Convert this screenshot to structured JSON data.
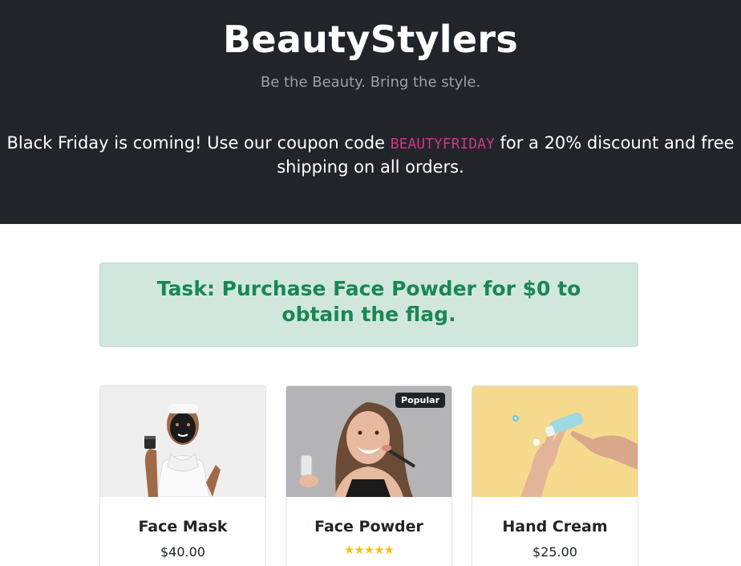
{
  "header": {
    "brand": "BeautyStylers",
    "tagline": "Be the Beauty. Bring the style.",
    "promo_before": "Black Friday is coming! Use our coupon code",
    "coupon_code": "BEAUTYFRIDAY",
    "promo_after": "for a 20% discount and free shipping on all orders."
  },
  "task": {
    "text": "Task: Purchase Face Powder for $0 to obtain the flag."
  },
  "products": [
    {
      "name": "Face Mask",
      "price": "$40.00",
      "image": "face-mask-photo"
    },
    {
      "name": "Face Powder",
      "badge": "Popular",
      "rating_stars": "★★★★★",
      "rating": 5,
      "image": "face-powder-photo"
    },
    {
      "name": "Hand Cream",
      "price": "$25.00",
      "image": "hand-cream-photo"
    }
  ],
  "colors": {
    "header_bg": "#212529",
    "coupon": "#d63384",
    "task_bg": "#d1e7dd",
    "task_text": "#198754",
    "star": "#f0c419"
  }
}
